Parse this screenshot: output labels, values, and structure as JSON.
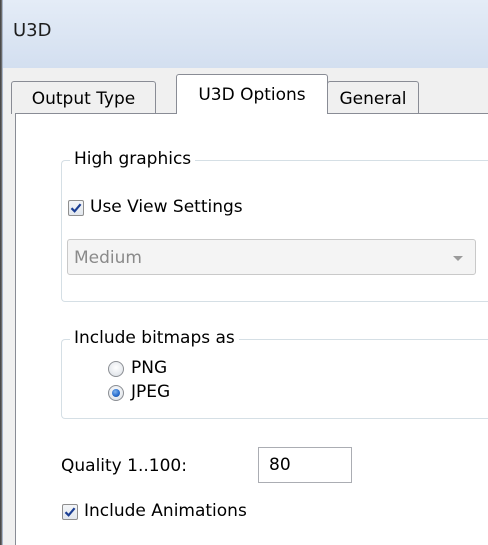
{
  "window": {
    "title": "U3D"
  },
  "tabs": [
    {
      "label": "Output Type",
      "active": false
    },
    {
      "label": "U3D Options",
      "active": true
    },
    {
      "label": "General",
      "active": false
    }
  ],
  "high_graphics": {
    "legend": "High graphics",
    "use_view_settings": {
      "label": "Use View Settings",
      "checked": true
    },
    "quality_select": {
      "value": "Medium",
      "enabled": false
    }
  },
  "bitmaps": {
    "legend": "Include bitmaps as",
    "options": [
      {
        "label": "PNG",
        "selected": false
      },
      {
        "label": "JPEG",
        "selected": true
      }
    ]
  },
  "quality": {
    "label": "Quality 1..100:",
    "value": "80"
  },
  "include_animations": {
    "label": "Include Animations",
    "checked": true
  },
  "colors": {
    "title_bar": "#dbe5f3",
    "check_mark": "#1c3f94",
    "radio_selected": "#2a6fcf"
  }
}
